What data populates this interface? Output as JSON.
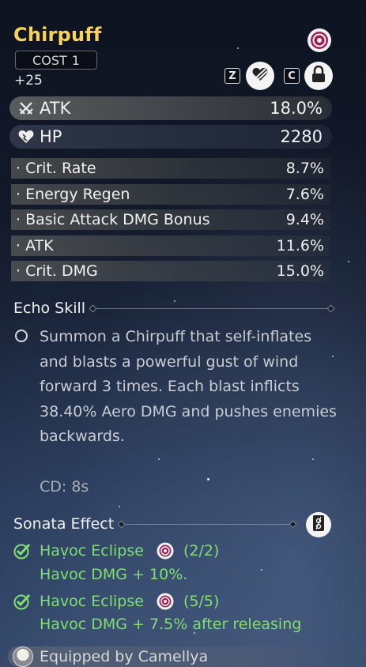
{
  "echo": {
    "name": "Chirpuff",
    "cost_label": "COST",
    "cost_value": "1",
    "level": "+25"
  },
  "controls": {
    "key_z": "Z",
    "key_c": "C"
  },
  "main_stats": [
    {
      "label": "ATK",
      "value": "18.0%",
      "icon": "crossed-swords-icon"
    },
    {
      "label": "HP",
      "value": "2280",
      "icon": "heart-icon"
    }
  ],
  "sub_stats": [
    {
      "label": "· Crit. Rate",
      "value": "8.7%"
    },
    {
      "label": "· Energy Regen",
      "value": "7.6%"
    },
    {
      "label": "· Basic Attack DMG Bonus",
      "value": "9.4%"
    },
    {
      "label": "· ATK",
      "value": "11.6%"
    },
    {
      "label": "· Crit. DMG",
      "value": "15.0%"
    }
  ],
  "echo_skill": {
    "heading": "Echo Skill",
    "description": "Summon a Chirpuff that self-inflates and blasts a powerful gust of wind forward 3 times. Each blast inflicts 38.40% Aero DMG and pushes enemies backwards.",
    "cooldown": "CD: 8s"
  },
  "sonata": {
    "heading": "Sonata Effect",
    "sets": [
      {
        "name": "Havoc Eclipse",
        "count": "(2/2)",
        "effect": "Havoc DMG + 10%."
      },
      {
        "name": "Havoc Eclipse",
        "count": "(5/5)",
        "effect": "Havoc DMG + 7.5% after releasing"
      }
    ]
  },
  "equipped": {
    "text": "Equipped by Camellya"
  },
  "colors": {
    "title": "#f6d35a",
    "set_active": "#7ee071",
    "havoc_sonata": "#a0255a"
  }
}
